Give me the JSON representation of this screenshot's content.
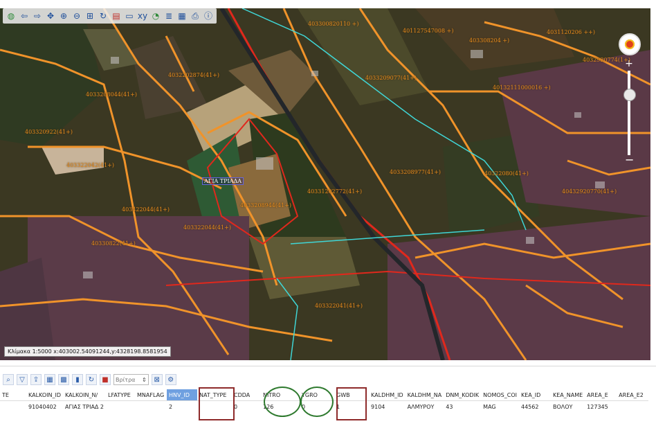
{
  "map": {
    "toolbar_icons": [
      "globe-icon",
      "back-arrow-icon",
      "forward-arrow-icon",
      "pan-icon",
      "zoom-in-icon",
      "zoom-out-icon",
      "zoom-box-icon",
      "refresh-icon",
      "layers-icon",
      "select-icon",
      "coordinates-icon",
      "measure-icon",
      "legend-icon",
      "overview-icon",
      "print-icon",
      "info-icon"
    ],
    "scale_readout": "Κλίμακα 1:5000 x:403002.54091244,y:4328198.8581954",
    "village_label": "ΑΓΙΑ ΤΡΙΑΔΑ",
    "parcel_labels": [
      "403300820110 +)",
      "401127547008 +)",
      "403308204 +)",
      "4031120206 ++)",
      "4032920774(1+)",
      "4032202874(41+)",
      "40132111000016 +)",
      "4033208044(41+)",
      "4033209077(41+)",
      "40331202772(41+)",
      "4033208977(41+)",
      "403322042(41+)",
      "4033208944(41+)",
      "403422044(41+)",
      "403322044(41+)",
      "403322041(41+)",
      "40330822(41+)",
      "403320922(41+)",
      "40322080(41+)",
      "40432920770(41+)"
    ]
  },
  "attributes": {
    "toolbar_icons": [
      "search-icon",
      "filter-icon",
      "export-icon",
      "table-icon",
      "grid-icon",
      "chart-icon",
      "refresh-icon",
      "stop-icon"
    ],
    "spinner_placeholder": "Βρίτρα",
    "columns": [
      "TE",
      "KALKOIN_ID",
      "KALKOIN_N/",
      "LFATYPE",
      "MNAFLAG",
      "HNV_ID",
      "NAT_TYPE",
      "CDDA",
      "NITRO",
      "YGRO",
      "GWB",
      "KALDHM_ID",
      "KALDHM_NA",
      "DNM_KODIK",
      "NOMOS_COI",
      "KEA_ID",
      "KEA_NAME",
      "AREA_E",
      "AREA_E2"
    ],
    "selected_column": "HNV_ID",
    "row": [
      "",
      "91040402",
      "ΑΓΙΑΣ ΤΡΙΑΔ 2",
      "",
      "",
      "2",
      "",
      "0",
      "126",
      "0",
      "1",
      "9104",
      "ΑΛΜΥΡΟΥ",
      "43",
      "MAG",
      "44562",
      "ΒΟΛΟΥ",
      "127345",
      ""
    ]
  },
  "colors": {
    "parcel_outline": "#f0932a",
    "road_red": "#e0281c",
    "stream": "#3fd6d6",
    "annotation_rect": "#8e2a2a",
    "annotation_oval": "#2f7a2f",
    "selected_header": "#6fa0e0"
  }
}
